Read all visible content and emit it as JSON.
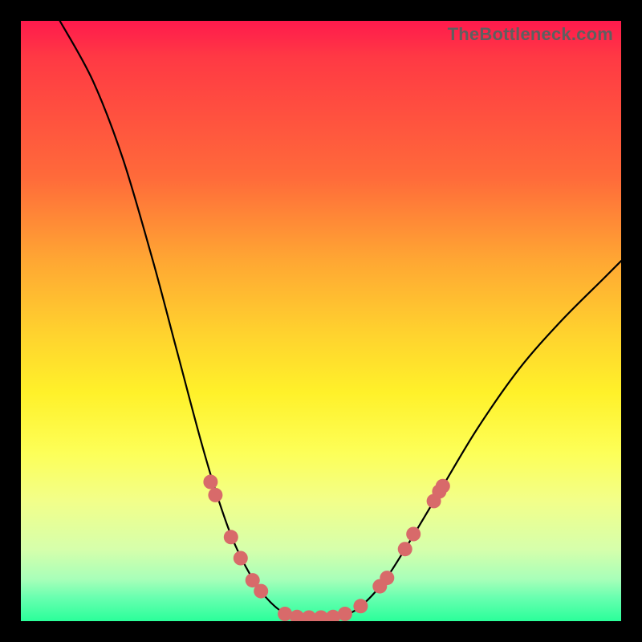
{
  "watermark": "TheBottleneck.com",
  "chart_data": {
    "type": "line",
    "title": "",
    "xlabel": "",
    "ylabel": "",
    "xlim": [
      0,
      1
    ],
    "ylim": [
      0,
      1
    ],
    "curve": [
      {
        "x": 0.065,
        "y": 1.0
      },
      {
        "x": 0.12,
        "y": 0.9
      },
      {
        "x": 0.17,
        "y": 0.77
      },
      {
        "x": 0.22,
        "y": 0.6
      },
      {
        "x": 0.26,
        "y": 0.45
      },
      {
        "x": 0.3,
        "y": 0.3
      },
      {
        "x": 0.33,
        "y": 0.2
      },
      {
        "x": 0.36,
        "y": 0.12
      },
      {
        "x": 0.4,
        "y": 0.05
      },
      {
        "x": 0.44,
        "y": 0.012
      },
      {
        "x": 0.47,
        "y": 0.006
      },
      {
        "x": 0.5,
        "y": 0.006
      },
      {
        "x": 0.53,
        "y": 0.008
      },
      {
        "x": 0.56,
        "y": 0.02
      },
      {
        "x": 0.6,
        "y": 0.06
      },
      {
        "x": 0.64,
        "y": 0.12
      },
      {
        "x": 0.7,
        "y": 0.22
      },
      {
        "x": 0.76,
        "y": 0.32
      },
      {
        "x": 0.83,
        "y": 0.42
      },
      {
        "x": 0.9,
        "y": 0.5
      },
      {
        "x": 0.97,
        "y": 0.57
      },
      {
        "x": 1.0,
        "y": 0.6
      }
    ],
    "markers": [
      {
        "x": 0.316,
        "y": 0.232
      },
      {
        "x": 0.324,
        "y": 0.21
      },
      {
        "x": 0.35,
        "y": 0.14
      },
      {
        "x": 0.366,
        "y": 0.105
      },
      {
        "x": 0.386,
        "y": 0.068
      },
      {
        "x": 0.4,
        "y": 0.05
      },
      {
        "x": 0.44,
        "y": 0.012
      },
      {
        "x": 0.46,
        "y": 0.007
      },
      {
        "x": 0.48,
        "y": 0.006
      },
      {
        "x": 0.5,
        "y": 0.006
      },
      {
        "x": 0.52,
        "y": 0.007
      },
      {
        "x": 0.54,
        "y": 0.012
      },
      {
        "x": 0.566,
        "y": 0.025
      },
      {
        "x": 0.598,
        "y": 0.058
      },
      {
        "x": 0.61,
        "y": 0.072
      },
      {
        "x": 0.64,
        "y": 0.12
      },
      {
        "x": 0.654,
        "y": 0.145
      },
      {
        "x": 0.688,
        "y": 0.2
      },
      {
        "x": 0.697,
        "y": 0.216
      },
      {
        "x": 0.703,
        "y": 0.225
      }
    ],
    "marker_radius_px": 9,
    "colors": {
      "curve": "#000000",
      "markers": "#d86a6a",
      "gradient_top": "#ff1a4d",
      "gradient_bottom": "#2aff9a",
      "background": "#000000"
    }
  }
}
